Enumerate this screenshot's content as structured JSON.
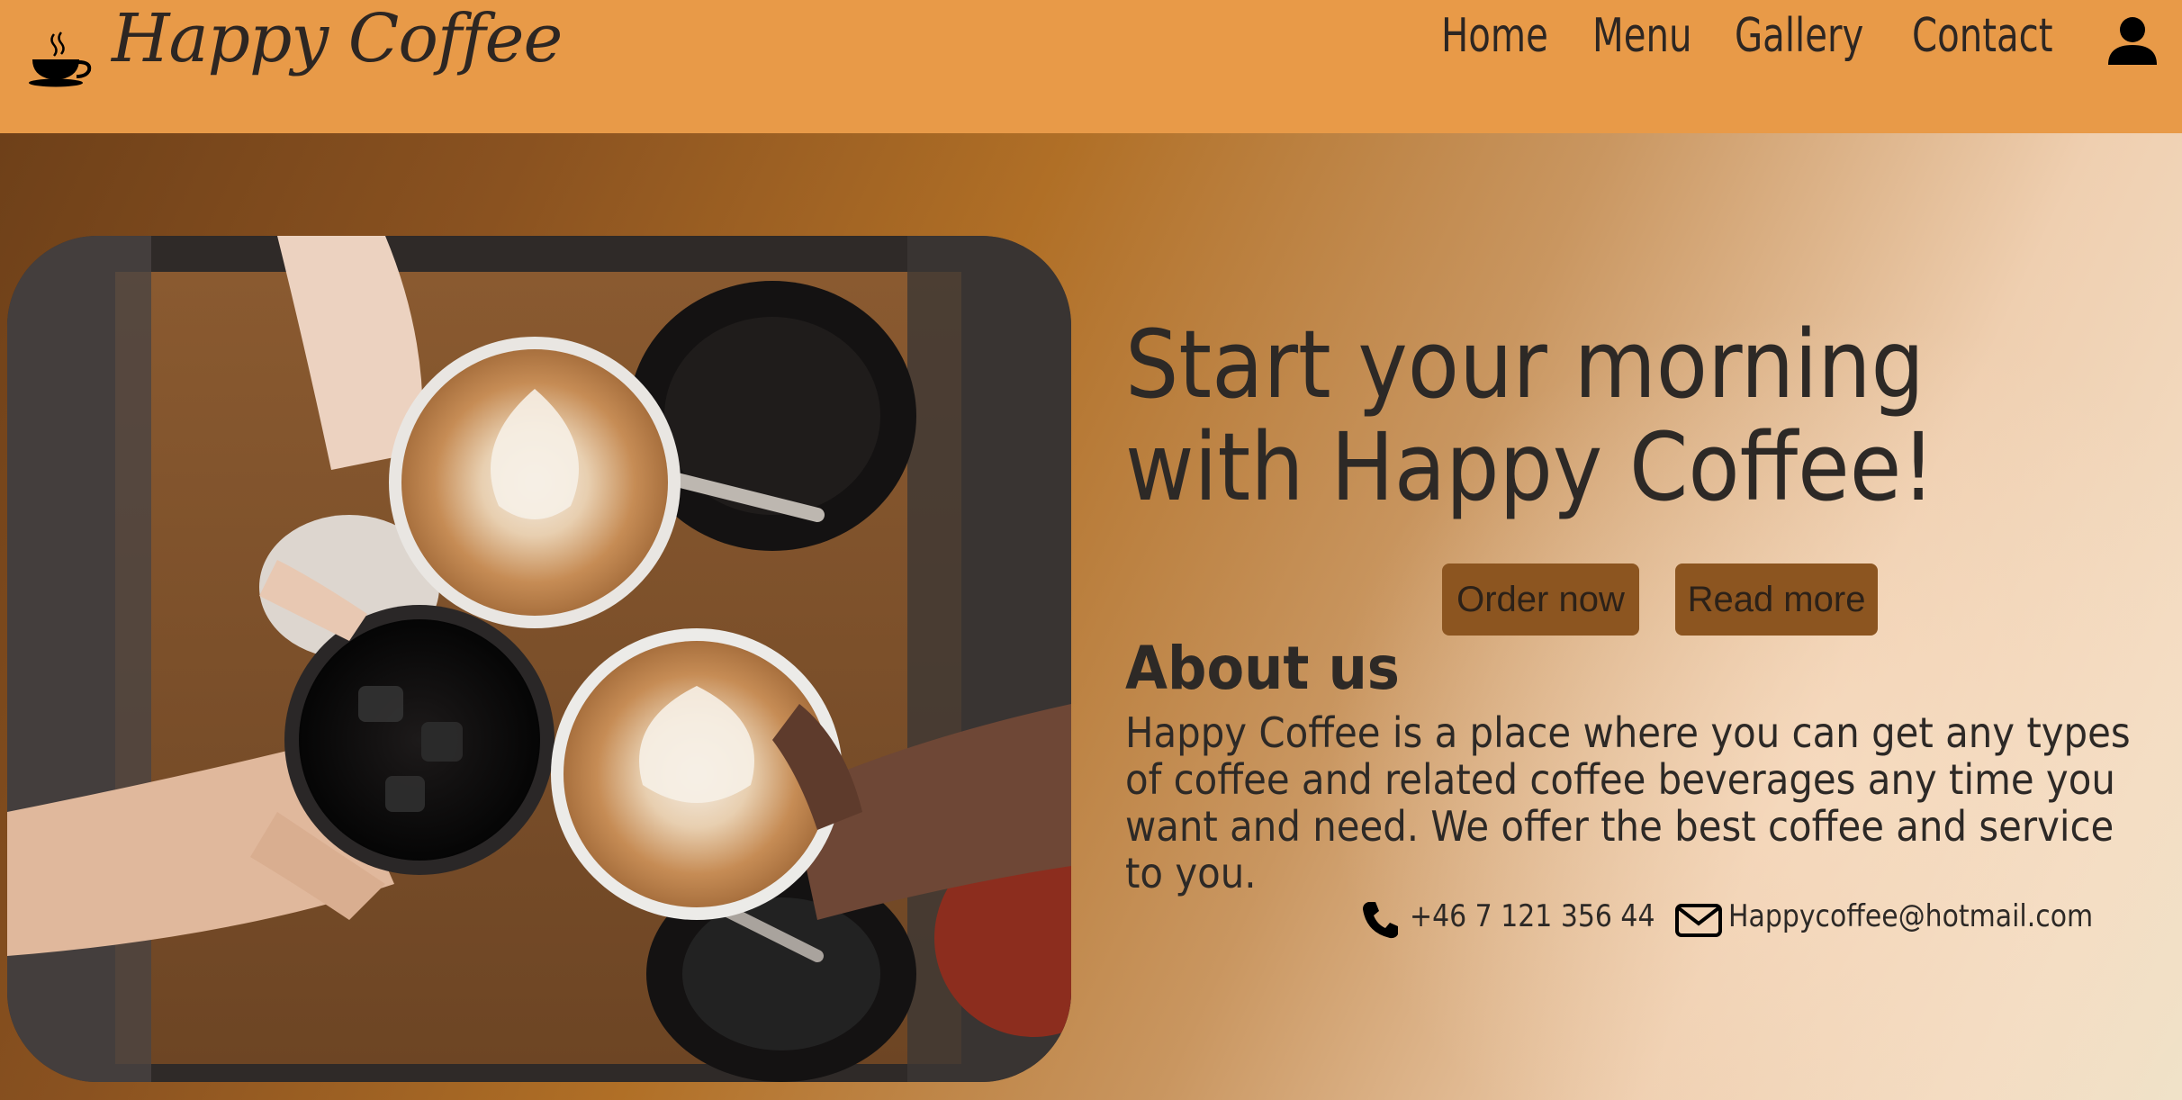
{
  "brand": {
    "name": "Happy Coffee",
    "logo_icon": "coffee-cup-icon"
  },
  "nav": {
    "items": [
      {
        "label": "Home"
      },
      {
        "label": "Menu"
      },
      {
        "label": "Gallery"
      },
      {
        "label": "Contact"
      }
    ],
    "account_icon": "user-icon"
  },
  "hero": {
    "title": "Start your morning with Happy Coffee!",
    "image_icon": "coffee-photo",
    "buttons": {
      "order_label": "Order now",
      "read_label": "Read more"
    }
  },
  "about": {
    "heading": "About us",
    "text": "Happy Coffee is a place where you can get any types of coffee and related coffee beverages any time you want and need. We offer the best coffee and service to you."
  },
  "contact": {
    "phone": "+46 7 121 356 44",
    "phone_icon": "phone-icon",
    "email": "Happycoffee@hotmail.com",
    "email_icon": "mail-icon"
  },
  "colors": {
    "nav_background": "#e89a48",
    "button_background": "#8c5520",
    "text": "#2d2926"
  }
}
